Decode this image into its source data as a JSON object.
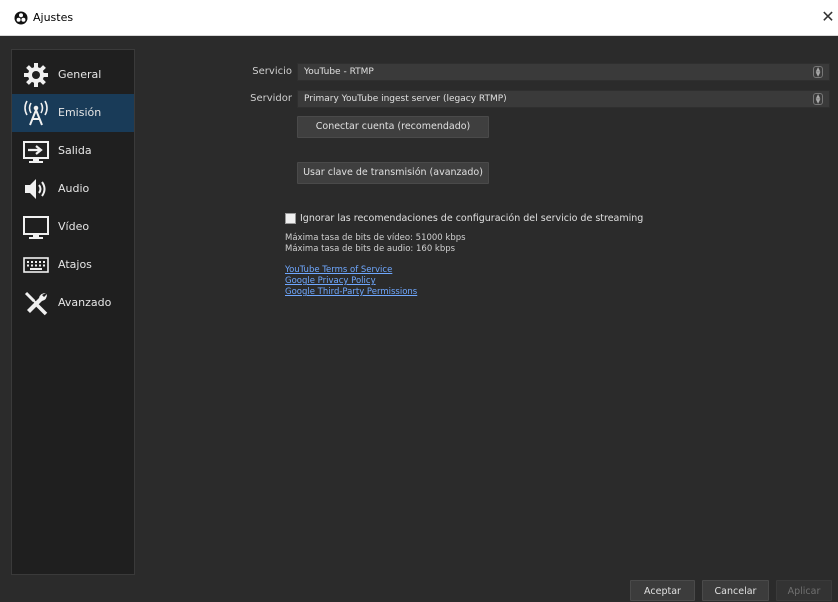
{
  "window": {
    "title": "Ajustes"
  },
  "sidebar": {
    "items": [
      {
        "label": "General",
        "icon": "gear-icon"
      },
      {
        "label": "Emisión",
        "icon": "broadcast-antenna-icon"
      },
      {
        "label": "Salida",
        "icon": "output-icon"
      },
      {
        "label": "Audio",
        "icon": "speaker-icon"
      },
      {
        "label": "Vídeo",
        "icon": "monitor-icon"
      },
      {
        "label": "Atajos",
        "icon": "keyboard-icon"
      },
      {
        "label": "Avanzado",
        "icon": "tools-icon"
      }
    ],
    "active_index": 1
  },
  "stream": {
    "service_label": "Servicio",
    "service_value": "YouTube - RTMP",
    "server_label": "Servidor",
    "server_value": "Primary YouTube ingest server (legacy RTMP)",
    "connect_button": "Conectar cuenta (recomendado)",
    "stream_key_button": "Usar clave de transmisión (avanzado)",
    "ignore_checkbox_label": "Ignorar las recomendaciones de configuración del servicio de streaming",
    "ignore_checked": false,
    "max_video_bitrate": "Máxima tasa de bits de vídeo: 51000 kbps",
    "max_audio_bitrate": "Máxima tasa de bits de audio: 160 kbps",
    "links": [
      "YouTube Terms of Service",
      "Google Privacy Policy",
      "Google Third-Party Permissions"
    ]
  },
  "footer": {
    "accept": "Aceptar",
    "cancel": "Cancelar",
    "apply": "Aplicar"
  },
  "colors": {
    "background": "#2b2b2b",
    "sidebar_bg": "#1f1f1f",
    "active_item": "#193b58",
    "link": "#6fa8ff"
  }
}
